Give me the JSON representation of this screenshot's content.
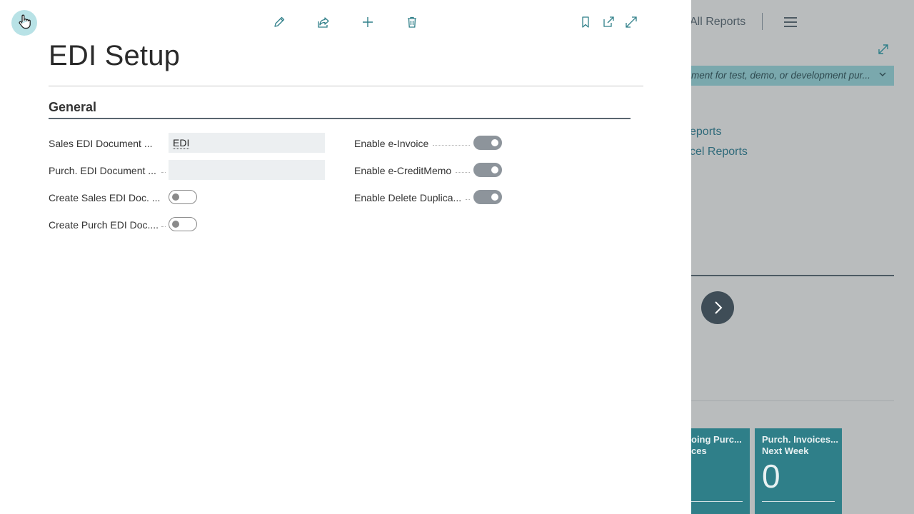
{
  "background_page": {
    "nav_item": "All Reports",
    "banner_text": "ment for test, demo, or development pur...",
    "links": [
      "eports",
      "cel Reports"
    ],
    "tiles": [
      {
        "title_line1": "oing Purc...",
        "title_line2": "ces",
        "value": ""
      },
      {
        "title_line1": "Purch. Invoices...",
        "title_line2": "Next Week",
        "value": "0"
      }
    ]
  },
  "dialog": {
    "title": "EDI Setup",
    "section": "General",
    "left_fields": [
      {
        "label": "Sales EDI Document ...",
        "value": "EDI",
        "type": "text"
      },
      {
        "label": "Purch. EDI Document ...",
        "value": "",
        "type": "text"
      },
      {
        "label": "Create Sales EDI Doc. ...",
        "state": "off",
        "type": "toggle"
      },
      {
        "label": "Create Purch EDI Doc....",
        "state": "off",
        "type": "toggle"
      }
    ],
    "right_fields": [
      {
        "label": "Enable e-Invoice",
        "state": "on",
        "type": "toggle"
      },
      {
        "label": "Enable e-CreditMemo",
        "state": "on",
        "type": "toggle"
      },
      {
        "label": "Enable Delete Duplica...",
        "state": "on",
        "type": "toggle"
      }
    ],
    "toolbar_icons": [
      "edit-icon",
      "share-icon",
      "new-icon",
      "delete-icon",
      "bookmark-icon",
      "open-in-new-window-icon",
      "expand-icon"
    ]
  },
  "colors": {
    "accent": "#2f7f89",
    "toggle_on": "#8d949b",
    "input_bg": "#eceff1"
  }
}
